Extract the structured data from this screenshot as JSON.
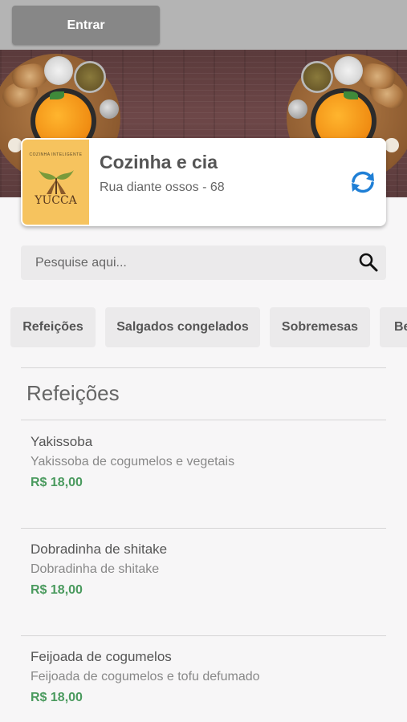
{
  "topbar": {
    "login_label": "Entrar"
  },
  "store": {
    "name": "Cozinha e cia",
    "address": "Rua diante ossos - 68",
    "logo_small_text": "COZINHA INTELIGENTE",
    "logo_brand": "YUCCA"
  },
  "search": {
    "placeholder": "Pesquise aqui..."
  },
  "categories": [
    {
      "label": "Refeições"
    },
    {
      "label": "Salgados congelados"
    },
    {
      "label": "Sobremesas"
    },
    {
      "label": "Be"
    }
  ],
  "section": {
    "title": "Refeições"
  },
  "items": [
    {
      "name": "Yakissoba",
      "description": "Yakissoba de cogumelos e vegetais",
      "price": "R$ 18,00"
    },
    {
      "name": "Dobradinha de shitake",
      "description": "Dobradinha de shitake",
      "price": "R$ 18,00"
    },
    {
      "name": "Feijoada de cogumelos",
      "description": "Feijoada de cogumelos e tofu defumado",
      "price": "R$ 18,00"
    }
  ],
  "icons": {
    "search": "search-icon",
    "refresh": "refresh-icon"
  },
  "colors": {
    "accent_blue": "#1f7fd6",
    "price_green": "#4a9a5e",
    "topbar": "#b4b4b4",
    "login_button": "#878787",
    "logo_bg": "#f6c35e"
  }
}
